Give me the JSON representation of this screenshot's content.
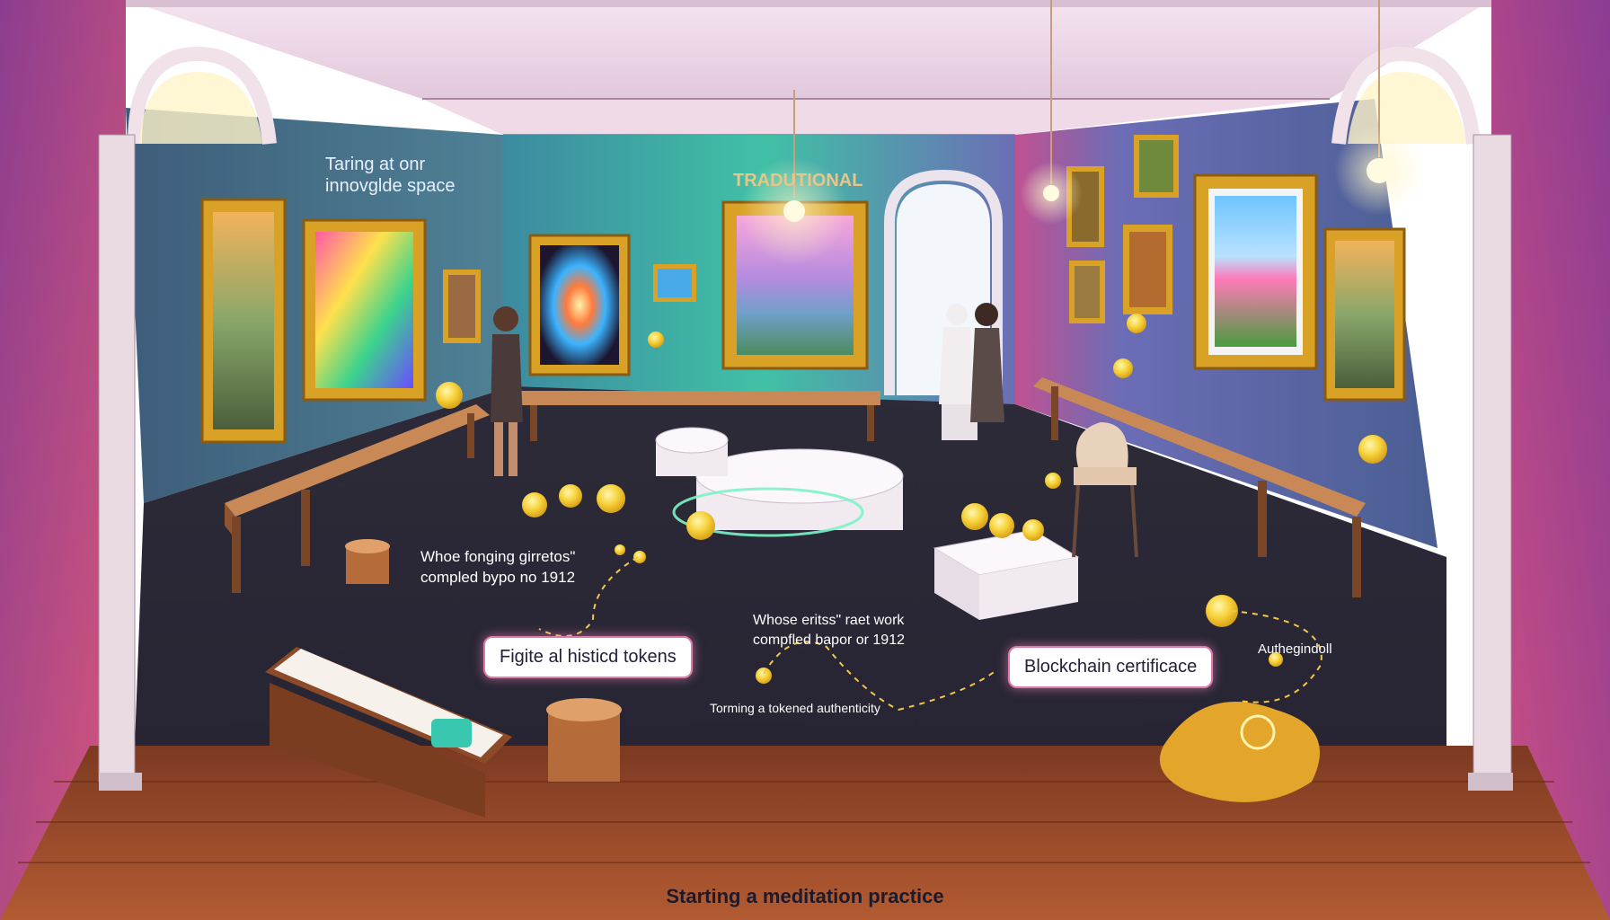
{
  "labels": {
    "top_left_line1": "Taring at onr",
    "top_left_line2": "innovglde space",
    "traditional": "TRADUTIONAL",
    "mid_left_line1": "Whoe fonging girretos\"",
    "mid_left_line2": "compled bypo no 1912",
    "mid_center_line1": "Whose eritss\" raet work",
    "mid_center_line2": "compfled bapor or 1912",
    "right_small": "Authegindoll",
    "bottom_center": "Torming a tokened authenticity"
  },
  "bubbles": {
    "tokens": "Figite al histicd tokens",
    "certificate": "Blockchain certificace"
  },
  "caption": "Starting a meditation practice",
  "colors": {
    "wall_left": "#4a6f86",
    "wall_back": "#3fb7a8",
    "wall_right": "#5a6ea0",
    "floor": "#2c2b3a",
    "wood_floor": "#9a4a2a",
    "frame_gold": "#d9a227",
    "coin": "#f7d23a",
    "arch_outer": "#c24e7d"
  }
}
